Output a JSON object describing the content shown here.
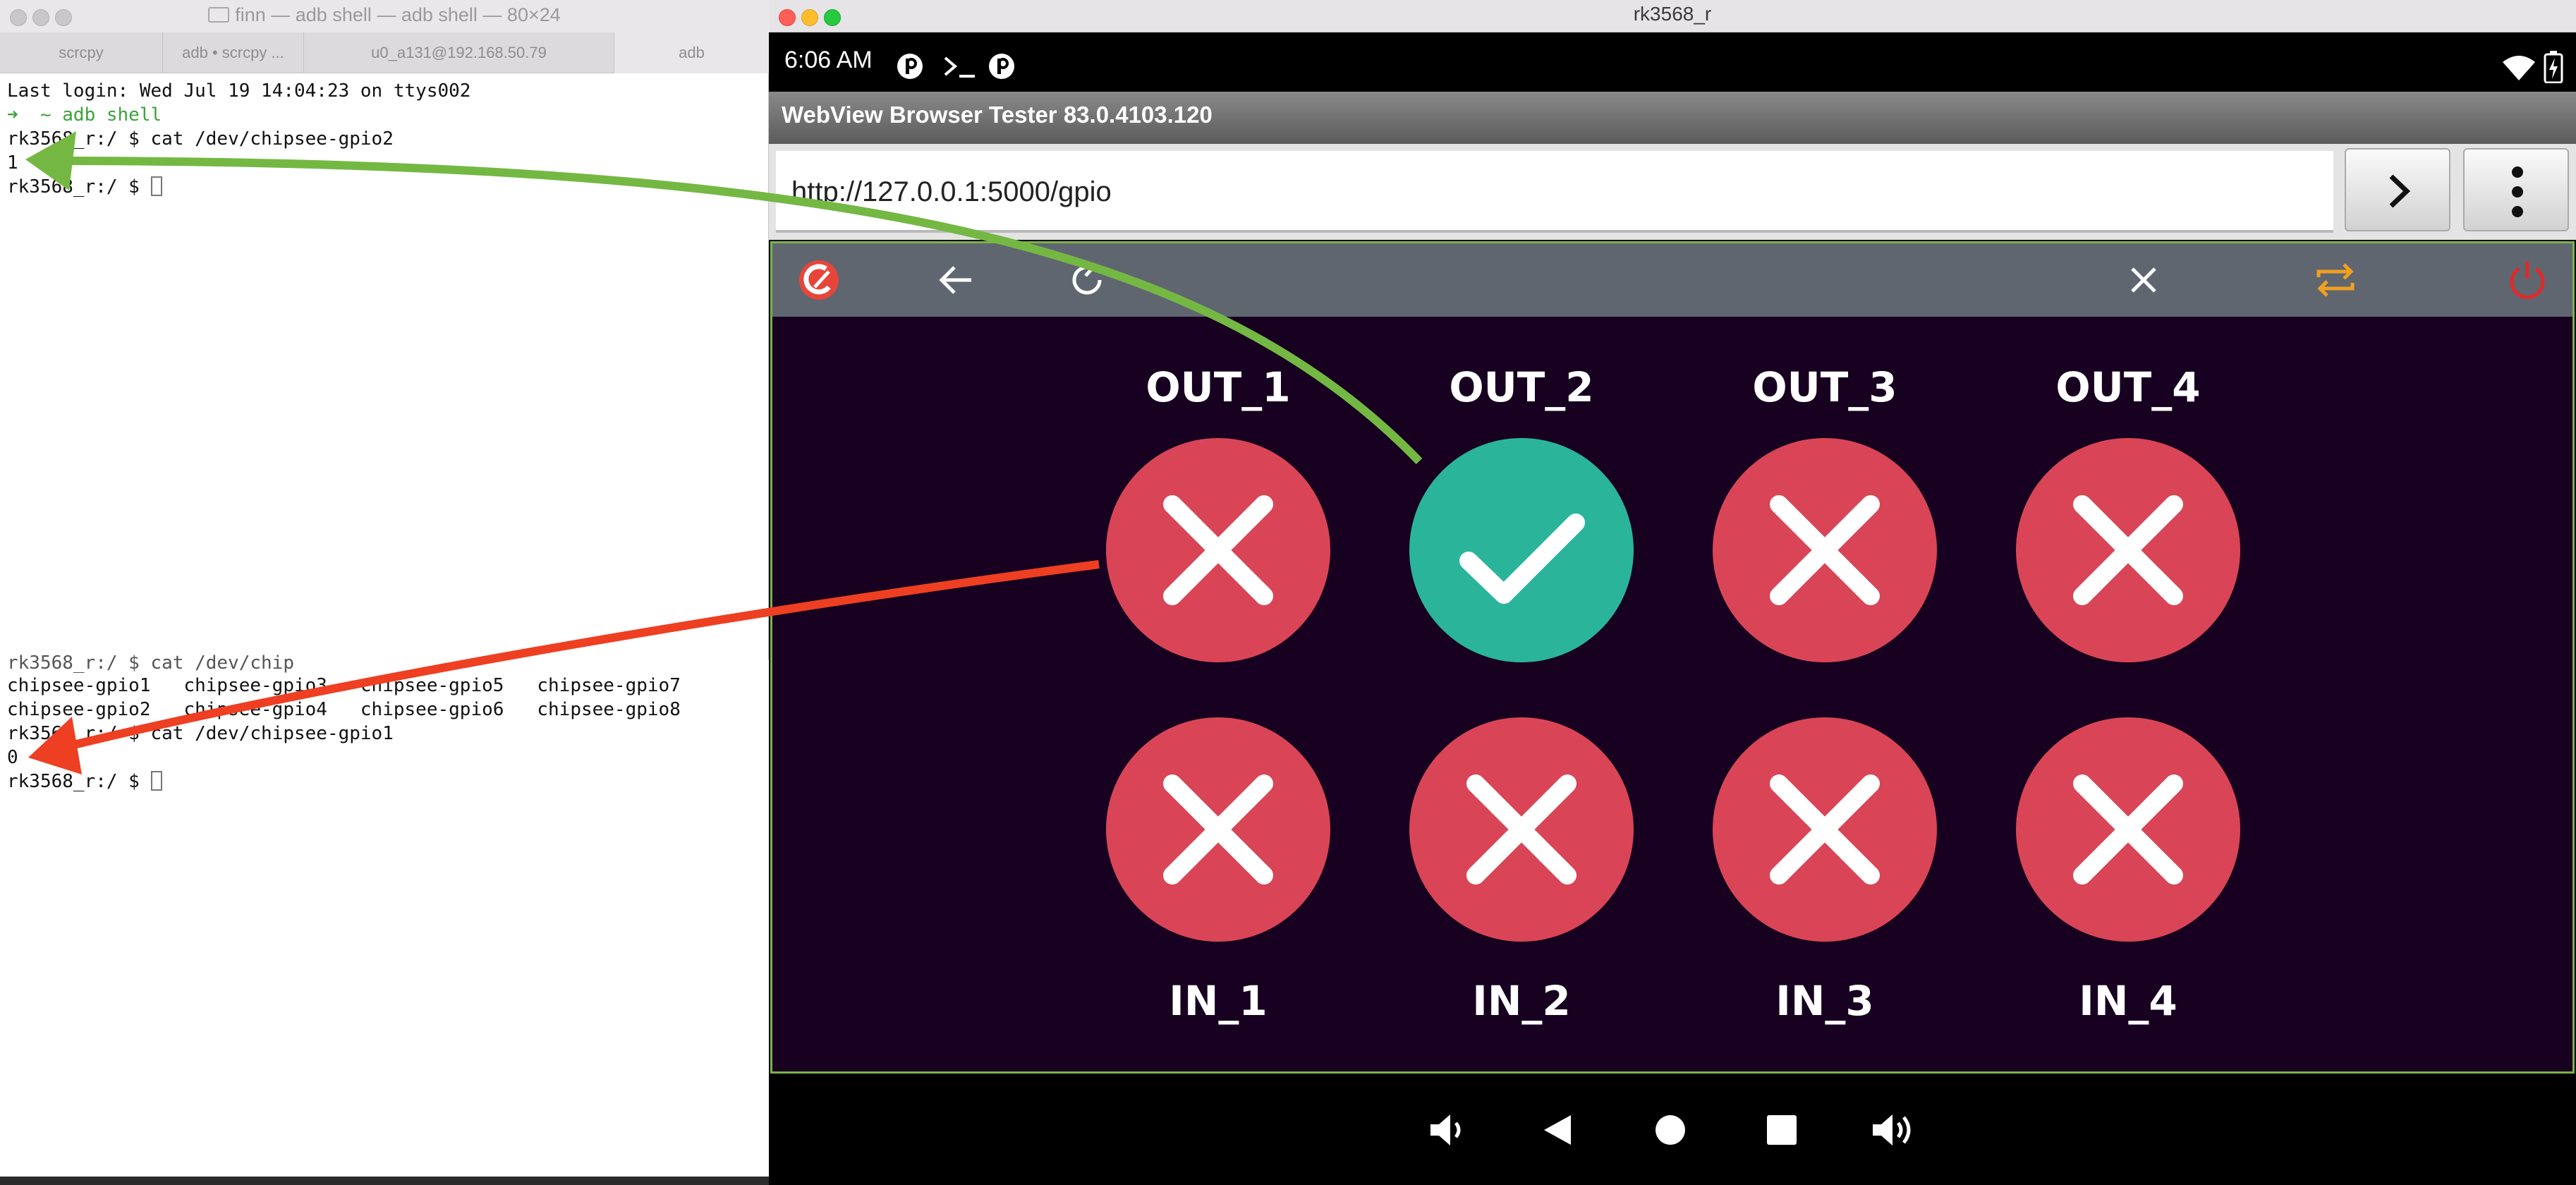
{
  "left_terminal": {
    "title": "finn — adb shell — adb shell — 80×24",
    "tabs": [
      "scrcpy",
      "adb • scrcpy ...",
      "u0_a131@192.168.50.79",
      "adb"
    ],
    "lines": [
      "Last login: Wed Jul 19 14:04:23 on ttys002",
      "➜  ~ adb shell",
      "rk3568_r:/ $ cat /dev/chipsee-gpio2",
      "1",
      "rk3568_r:/ $ "
    ]
  },
  "bottom_terminal": {
    "lines": [
      "rk3568_r:/ $ cat /dev/chip",
      "chipsee-gpio1   chipsee-gpio3   chipsee-gpio5   chipsee-gpio7",
      "chipsee-gpio2   chipsee-gpio4   chipsee-gpio6   chipsee-gpio8",
      "rk3568_r:/ $ cat /dev/chipsee-gpio1",
      "0",
      "rk3568_r:/ $ "
    ]
  },
  "device_window": {
    "title": "rk3568_r",
    "status_time": "6:06 AM",
    "app_title": "WebView Browser Tester 83.0.4103.120",
    "url": "http://127.0.0.1:5000/gpio"
  },
  "gpio": {
    "outputs": [
      {
        "label": "OUT_1",
        "state": "off"
      },
      {
        "label": "OUT_2",
        "state": "on"
      },
      {
        "label": "OUT_3",
        "state": "off"
      },
      {
        "label": "OUT_4",
        "state": "off"
      }
    ],
    "inputs": [
      {
        "label": "IN_1",
        "state": "off"
      },
      {
        "label": "IN_2",
        "state": "off"
      },
      {
        "label": "IN_3",
        "state": "off"
      },
      {
        "label": "IN_4",
        "state": "off"
      }
    ]
  },
  "colors": {
    "on": "#2ab59a",
    "off": "#d94556",
    "arrow_green": "#74b843",
    "arrow_red": "#ee3f22",
    "page_bg": "#170020",
    "toolbar_bg": "#5f6670"
  }
}
